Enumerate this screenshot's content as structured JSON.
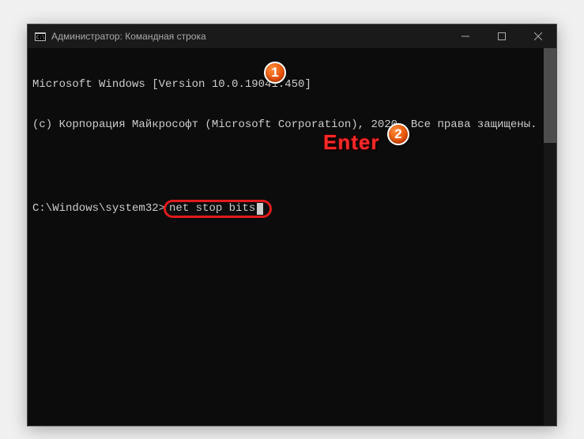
{
  "window": {
    "title": "Администратор: Командная строка"
  },
  "terminal": {
    "line1": "Microsoft Windows [Version 10.0.19041.450]",
    "line2": "(c) Корпорация Майкрософт (Microsoft Corporation), 2020. Все права защищены.",
    "prompt_prefix": "C:\\Windows\\system32>",
    "command": "net stop bits"
  },
  "annotations": {
    "badge1": "1",
    "badge2": "2",
    "enter_label": "Enter"
  }
}
